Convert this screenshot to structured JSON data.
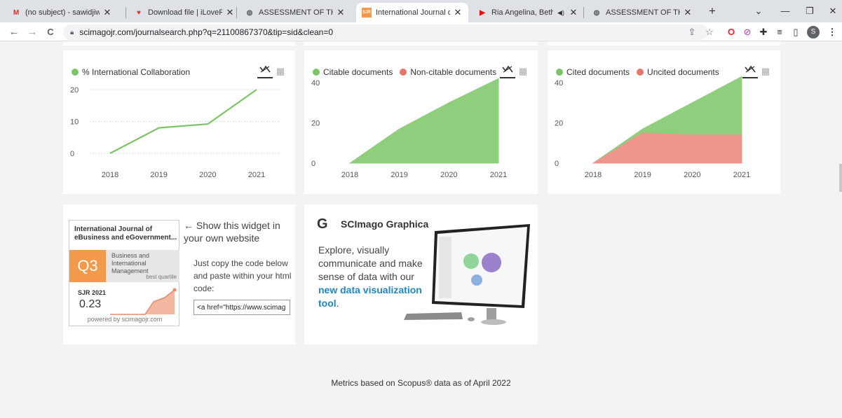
{
  "browser": {
    "tabs": [
      {
        "title": "(no subject) - sawidjiw@pp",
        "icon": "gmail-icon",
        "icon_glyph": "M",
        "icon_color": "#d93025",
        "active": false
      },
      {
        "title": "Download file | iLovePDF",
        "icon": "ilovepdf-icon",
        "icon_glyph": "♥",
        "icon_color": "#e5322d",
        "active": false
      },
      {
        "title": "ASSESSMENT OF THE COM",
        "icon": "globe-icon",
        "icon_glyph": "◍",
        "icon_color": "#5f6368",
        "active": false
      },
      {
        "title": "International Journal of eB",
        "icon": "sjr-icon",
        "icon_glyph": "SJR",
        "icon_color": "#f29a4a",
        "active": true
      },
      {
        "title": "Ria Angelina, Betharia",
        "icon": "youtube-icon",
        "icon_glyph": "▶",
        "icon_color": "#ff0000",
        "active": false,
        "audio": "◀)"
      },
      {
        "title": "ASSESSMENT OF THE COM",
        "icon": "globe-icon",
        "icon_glyph": "◍",
        "icon_color": "#5f6368",
        "active": false
      }
    ],
    "new_tab": "+",
    "close_glyph": "✕",
    "window_controls": {
      "dropdown": "⌄",
      "minimize": "—",
      "restore": "❐",
      "close": "✕"
    },
    "nav": {
      "back": "←",
      "forward": "→",
      "reload": "C"
    },
    "url": "scimagojr.com/journalsearch.php?q=21100867370&tip=sid&clean=0",
    "toolbar_icons": {
      "share": "⇪",
      "star": "☆",
      "opera": "O",
      "block": "⊘",
      "puzzle": "✚",
      "playlist": "≡",
      "sidepanel": "▯",
      "profile": "S",
      "menu": "⋮"
    }
  },
  "charts": [
    {
      "legend": [
        {
          "label": "% International Collaboration",
          "color": "#7bc566"
        }
      ],
      "icons": {
        "line": "✕̸",
        "table": "▦"
      },
      "chart_data": {
        "type": "line",
        "categories": [
          "2018",
          "2019",
          "2020",
          "2021"
        ],
        "series": [
          {
            "name": "% International Collaboration",
            "values": [
              0,
              8,
              9.2,
              20
            ],
            "color": "#7bc566"
          }
        ],
        "ylim": [
          0,
          20
        ],
        "yticks": [
          "0",
          "10",
          "20"
        ],
        "grid": true
      }
    },
    {
      "legend": [
        {
          "label": "Citable documents",
          "color": "#7bc566"
        },
        {
          "label": "Non-citable documents",
          "color": "#e8756a"
        }
      ],
      "icons": {
        "line": "✕̸",
        "table": "▦"
      },
      "chart_data": {
        "type": "area",
        "categories": [
          "2018",
          "2019",
          "2020",
          "2021"
        ],
        "series": [
          {
            "name": "Citable documents",
            "values": [
              0,
              17,
              30,
              42
            ],
            "color": "#8fce7c"
          },
          {
            "name": "Non-citable documents",
            "values": [
              0,
              0,
              0,
              0
            ],
            "color": "#f0958c"
          }
        ],
        "ylim": [
          0,
          40
        ],
        "yticks": [
          "0",
          "20",
          "40"
        ]
      }
    },
    {
      "legend": [
        {
          "label": "Cited documents",
          "color": "#7bc566"
        },
        {
          "label": "Uncited documents",
          "color": "#e8756a"
        }
      ],
      "icons": {
        "line": "✕̸",
        "table": "▦"
      },
      "chart_data": {
        "type": "area",
        "categories": [
          "2018",
          "2019",
          "2020",
          "2021"
        ],
        "series": [
          {
            "name": "Cited documents",
            "values": [
              0,
              2,
              16,
              29
            ],
            "color": "#8fce7c"
          },
          {
            "name": "Uncited documents",
            "values": [
              0,
              15,
              14,
              14
            ],
            "color": "#f0958c"
          }
        ],
        "stacked": true,
        "ylim": [
          0,
          40
        ],
        "yticks": [
          "0",
          "20",
          "40"
        ]
      }
    }
  ],
  "widget": {
    "journal": "International Journal of eBusiness and eGovernment...",
    "quartile": "Q3",
    "category": "Business and International Management",
    "best_quartile": "best quartile",
    "sjr_label": "SJR 2021",
    "sjr_value": "0.23",
    "powered_by": "powered by scimagojr.com",
    "show_text": "← Show this widget in your own website",
    "copy_text": "Just copy the code below and paste within your html code:",
    "code_value": "<a href=\"https://www.scimag",
    "spark_color": "#e8896a"
  },
  "graphica": {
    "logo": "G",
    "title": "SCImago Graphica",
    "text_plain": "Explore, visually communicate and make sense of data with our ",
    "link": "new data visualization tool",
    "suffix": "."
  },
  "footer": "Metrics based on Scopus® data as of April 2022"
}
